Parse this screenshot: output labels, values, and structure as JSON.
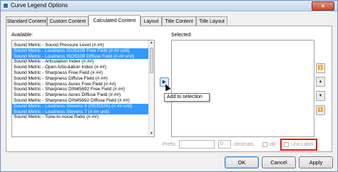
{
  "window": {
    "title": "Curve Legend Options",
    "close_glyph": "×"
  },
  "tabs": [
    {
      "label": "Standard Content",
      "active": false
    },
    {
      "label": "Custom Content",
      "active": false
    },
    {
      "label": "Calculated Content",
      "active": true
    },
    {
      "label": "Layout",
      "active": false
    },
    {
      "label": "Title Content",
      "active": false
    },
    {
      "label": "Title Layout",
      "active": false
    }
  ],
  "available": {
    "label": "Available:",
    "items": [
      {
        "text": "Sound Metric - Sound Pressure Level (#.##)",
        "selected": false
      },
      {
        "text": "Sound Metric - Loudness ISO532B Free Field (#.## unit)",
        "selected": true
      },
      {
        "text": "Sound Metric - Loudness ISO532B Diffuse Field (#.## unit)",
        "selected": true
      },
      {
        "text": "Sound Metric - Articulation Index (#.##)",
        "selected": false
      },
      {
        "text": "Sound Metric - Open Articulation Index (#.##)",
        "selected": false
      },
      {
        "text": "Sound Metric - Sharpness Free Field (#.##)",
        "selected": false
      },
      {
        "text": "Sound Metric - Sharpness Diffuse Field (#.##)",
        "selected": false
      },
      {
        "text": "Sound Metric - Sharpness Aures Free Field (#.##)",
        "selected": false
      },
      {
        "text": "Sound Metric - Sharpness DIN45692 Free Field (#.##)",
        "selected": false
      },
      {
        "text": "Sound Metric - Sharpness Aures Diffuse Field (#.##)",
        "selected": false
      },
      {
        "text": "Sound Metric - Sharpness DIN45692 Diffuse Field (#.##)",
        "selected": false
      },
      {
        "text": "Sound Metric - Loudness Stevens 6 (ISO532A) (#.## unit)",
        "selected": true
      },
      {
        "text": "Sound Metric - Loudness Stevens 7 (#.## unit)",
        "selected": true
      },
      {
        "text": "Sound Metric - Tone-to-noise Ratio (#.##)",
        "selected": false
      }
    ]
  },
  "selected": {
    "label": "Selected:"
  },
  "add_button": {
    "glyph": "▶",
    "icon": "right-arrow-icon"
  },
  "tooltip": "Add to selection",
  "side_buttons": [
    {
      "icon": "move-to-top-icon",
      "glyph": "⏫"
    },
    {
      "icon": "move-up-icon",
      "glyph": "▲"
    },
    {
      "icon": "move-down-icon",
      "glyph": "▼"
    },
    {
      "icon": "move-to-bottom-icon",
      "glyph": "⏬"
    }
  ],
  "options": {
    "prefix_label": "Prefix:",
    "decimals_value": "0",
    "decimals_label": "decimals",
    "db_label": "dB",
    "unit_label": "Unit Label",
    "highlight_color": "#e01b1b"
  },
  "buttons": {
    "ok": "OK",
    "cancel": "Cancel",
    "apply": "Apply"
  }
}
